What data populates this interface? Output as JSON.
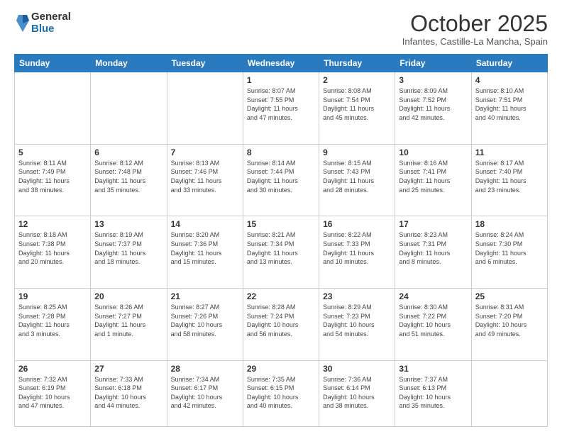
{
  "logo": {
    "general": "General",
    "blue": "Blue"
  },
  "header": {
    "month": "October 2025",
    "location": "Infantes, Castille-La Mancha, Spain"
  },
  "days_of_week": [
    "Sunday",
    "Monday",
    "Tuesday",
    "Wednesday",
    "Thursday",
    "Friday",
    "Saturday"
  ],
  "weeks": [
    [
      {
        "day": "",
        "info": ""
      },
      {
        "day": "",
        "info": ""
      },
      {
        "day": "",
        "info": ""
      },
      {
        "day": "1",
        "info": "Sunrise: 8:07 AM\nSunset: 7:55 PM\nDaylight: 11 hours\nand 47 minutes."
      },
      {
        "day": "2",
        "info": "Sunrise: 8:08 AM\nSunset: 7:54 PM\nDaylight: 11 hours\nand 45 minutes."
      },
      {
        "day": "3",
        "info": "Sunrise: 8:09 AM\nSunset: 7:52 PM\nDaylight: 11 hours\nand 42 minutes."
      },
      {
        "day": "4",
        "info": "Sunrise: 8:10 AM\nSunset: 7:51 PM\nDaylight: 11 hours\nand 40 minutes."
      }
    ],
    [
      {
        "day": "5",
        "info": "Sunrise: 8:11 AM\nSunset: 7:49 PM\nDaylight: 11 hours\nand 38 minutes."
      },
      {
        "day": "6",
        "info": "Sunrise: 8:12 AM\nSunset: 7:48 PM\nDaylight: 11 hours\nand 35 minutes."
      },
      {
        "day": "7",
        "info": "Sunrise: 8:13 AM\nSunset: 7:46 PM\nDaylight: 11 hours\nand 33 minutes."
      },
      {
        "day": "8",
        "info": "Sunrise: 8:14 AM\nSunset: 7:44 PM\nDaylight: 11 hours\nand 30 minutes."
      },
      {
        "day": "9",
        "info": "Sunrise: 8:15 AM\nSunset: 7:43 PM\nDaylight: 11 hours\nand 28 minutes."
      },
      {
        "day": "10",
        "info": "Sunrise: 8:16 AM\nSunset: 7:41 PM\nDaylight: 11 hours\nand 25 minutes."
      },
      {
        "day": "11",
        "info": "Sunrise: 8:17 AM\nSunset: 7:40 PM\nDaylight: 11 hours\nand 23 minutes."
      }
    ],
    [
      {
        "day": "12",
        "info": "Sunrise: 8:18 AM\nSunset: 7:38 PM\nDaylight: 11 hours\nand 20 minutes."
      },
      {
        "day": "13",
        "info": "Sunrise: 8:19 AM\nSunset: 7:37 PM\nDaylight: 11 hours\nand 18 minutes."
      },
      {
        "day": "14",
        "info": "Sunrise: 8:20 AM\nSunset: 7:36 PM\nDaylight: 11 hours\nand 15 minutes."
      },
      {
        "day": "15",
        "info": "Sunrise: 8:21 AM\nSunset: 7:34 PM\nDaylight: 11 hours\nand 13 minutes."
      },
      {
        "day": "16",
        "info": "Sunrise: 8:22 AM\nSunset: 7:33 PM\nDaylight: 11 hours\nand 10 minutes."
      },
      {
        "day": "17",
        "info": "Sunrise: 8:23 AM\nSunset: 7:31 PM\nDaylight: 11 hours\nand 8 minutes."
      },
      {
        "day": "18",
        "info": "Sunrise: 8:24 AM\nSunset: 7:30 PM\nDaylight: 11 hours\nand 6 minutes."
      }
    ],
    [
      {
        "day": "19",
        "info": "Sunrise: 8:25 AM\nSunset: 7:28 PM\nDaylight: 11 hours\nand 3 minutes."
      },
      {
        "day": "20",
        "info": "Sunrise: 8:26 AM\nSunset: 7:27 PM\nDaylight: 11 hours\nand 1 minute."
      },
      {
        "day": "21",
        "info": "Sunrise: 8:27 AM\nSunset: 7:26 PM\nDaylight: 10 hours\nand 58 minutes."
      },
      {
        "day": "22",
        "info": "Sunrise: 8:28 AM\nSunset: 7:24 PM\nDaylight: 10 hours\nand 56 minutes."
      },
      {
        "day": "23",
        "info": "Sunrise: 8:29 AM\nSunset: 7:23 PM\nDaylight: 10 hours\nand 54 minutes."
      },
      {
        "day": "24",
        "info": "Sunrise: 8:30 AM\nSunset: 7:22 PM\nDaylight: 10 hours\nand 51 minutes."
      },
      {
        "day": "25",
        "info": "Sunrise: 8:31 AM\nSunset: 7:20 PM\nDaylight: 10 hours\nand 49 minutes."
      }
    ],
    [
      {
        "day": "26",
        "info": "Sunrise: 7:32 AM\nSunset: 6:19 PM\nDaylight: 10 hours\nand 47 minutes."
      },
      {
        "day": "27",
        "info": "Sunrise: 7:33 AM\nSunset: 6:18 PM\nDaylight: 10 hours\nand 44 minutes."
      },
      {
        "day": "28",
        "info": "Sunrise: 7:34 AM\nSunset: 6:17 PM\nDaylight: 10 hours\nand 42 minutes."
      },
      {
        "day": "29",
        "info": "Sunrise: 7:35 AM\nSunset: 6:15 PM\nDaylight: 10 hours\nand 40 minutes."
      },
      {
        "day": "30",
        "info": "Sunrise: 7:36 AM\nSunset: 6:14 PM\nDaylight: 10 hours\nand 38 minutes."
      },
      {
        "day": "31",
        "info": "Sunrise: 7:37 AM\nSunset: 6:13 PM\nDaylight: 10 hours\nand 35 minutes."
      },
      {
        "day": "",
        "info": ""
      }
    ]
  ]
}
